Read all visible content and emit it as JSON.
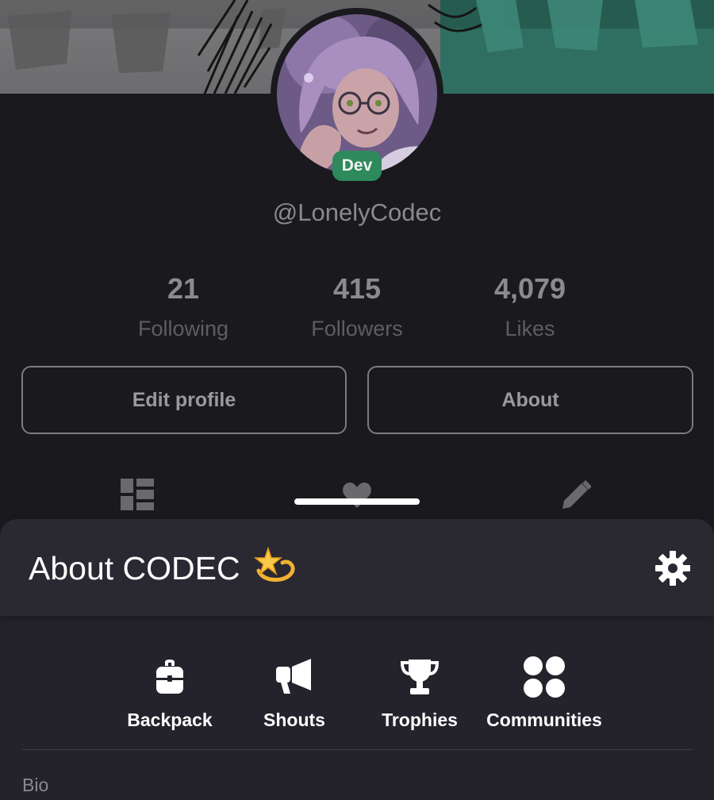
{
  "profile": {
    "username": "@LonelyCodec",
    "role_badge": "Dev"
  },
  "stats": [
    {
      "value": "21",
      "label": "Following"
    },
    {
      "value": "415",
      "label": "Followers"
    },
    {
      "value": "4,079",
      "label": "Likes"
    }
  ],
  "buttons": {
    "edit_profile": "Edit profile",
    "about": "About"
  },
  "tabs": [
    {
      "icon": "dashboard-icon"
    },
    {
      "icon": "heart-icon"
    },
    {
      "icon": "pencil-icon"
    }
  ],
  "sheet": {
    "title": "About CODEC",
    "title_emoji": "dizzy-star-emoji",
    "settings_icon": "gear-icon",
    "actions": [
      {
        "label": "Backpack",
        "icon": "backpack-icon"
      },
      {
        "label": "Shouts",
        "icon": "megaphone-icon"
      },
      {
        "label": "Trophies",
        "icon": "trophy-icon"
      },
      {
        "label": "Communities",
        "icon": "communities-icon"
      }
    ],
    "bio_label": "Bio"
  },
  "colors": {
    "background": "#1a191e",
    "sheet": "#24232b",
    "badge": "#2e8a5c",
    "banner_right": "#2f6f62"
  }
}
